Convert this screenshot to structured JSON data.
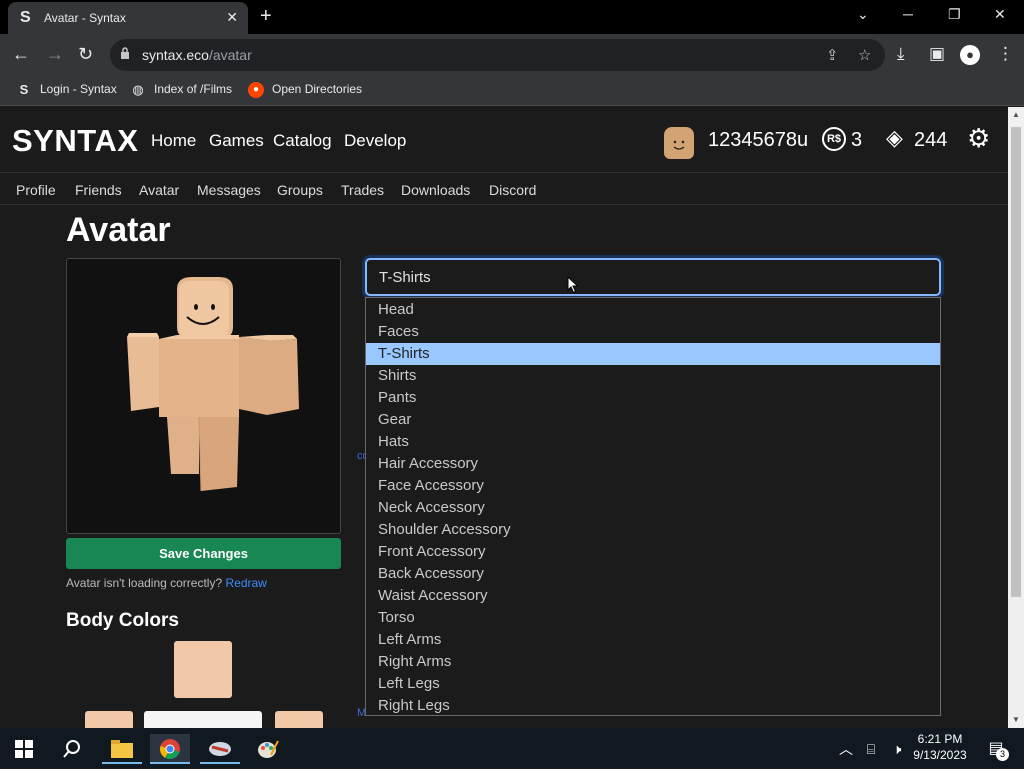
{
  "browser": {
    "tab_title": "Avatar - Syntax",
    "tab_favicon": "S",
    "url_host": "syntax.eco",
    "url_path": "/avatar",
    "bookmarks": [
      {
        "label": "Login - Syntax",
        "icon": "S"
      },
      {
        "label": "Index of /Films",
        "icon": "globe-icon"
      },
      {
        "label": "Open Directories",
        "icon": "reddit-icon"
      }
    ]
  },
  "site": {
    "logo": "SYNTAX",
    "topnav": [
      "Home",
      "Games",
      "Catalog",
      "Develop"
    ],
    "username": "12345678u",
    "robux_symbol": "R$",
    "robux": "3",
    "tix": "244",
    "subnav": [
      "Profile",
      "Friends",
      "Avatar",
      "Messages",
      "Groups",
      "Trades",
      "Downloads",
      "Discord"
    ]
  },
  "main": {
    "title": "Avatar",
    "save_button": "Save Changes",
    "redraw_prompt": "Avatar isn't loading correctly?",
    "redraw_link": "Redraw",
    "body_colors_title": "Body Colors",
    "skin_color": "#f2c9a8",
    "ghost_text_1": "co",
    "ghost_text_2": "Man Face"
  },
  "category_select": {
    "selected": "T-Shirts",
    "options": [
      "Head",
      "Faces",
      "T-Shirts",
      "Shirts",
      "Pants",
      "Gear",
      "Hats",
      "Hair Accessory",
      "Face Accessory",
      "Neck Accessory",
      "Shoulder Accessory",
      "Front Accessory",
      "Back Accessory",
      "Waist Accessory",
      "Torso",
      "Left Arms",
      "Right Arms",
      "Left Legs",
      "Right Legs"
    ],
    "selected_index": 2
  },
  "taskbar": {
    "time": "6:21 PM",
    "date": "9/13/2023",
    "notifications": "3"
  }
}
